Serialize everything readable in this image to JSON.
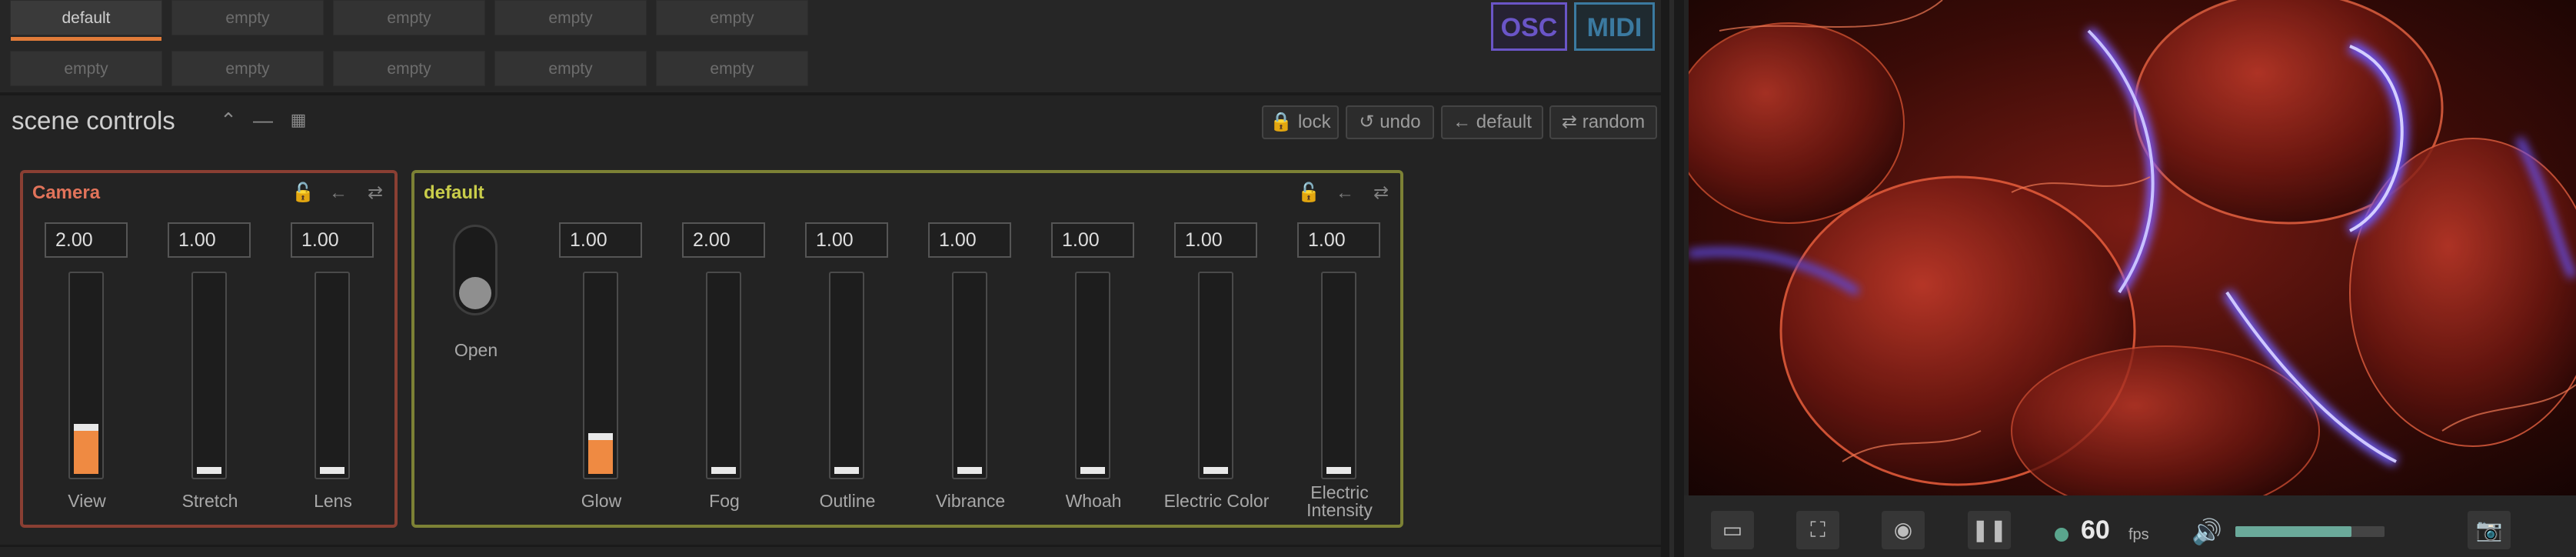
{
  "presets": {
    "row1": [
      "default",
      "empty",
      "empty",
      "empty",
      "empty"
    ],
    "row2": [
      "empty",
      "empty",
      "empty",
      "empty",
      "empty"
    ],
    "active_index": 0
  },
  "protocols": {
    "osc": "OSC",
    "midi": "MIDI"
  },
  "scene": {
    "title": "scene controls",
    "buttons": {
      "lock": "lock",
      "undo": "undo",
      "default": "default",
      "random": "random"
    }
  },
  "groups": {
    "camera": {
      "title": "Camera",
      "color": "#b5513f",
      "controls": [
        {
          "label": "View",
          "value": "2.00",
          "level": 0.22
        },
        {
          "label": "Stretch",
          "value": "1.00",
          "level": 0.0
        },
        {
          "label": "Lens",
          "value": "1.00",
          "level": 0.0
        }
      ]
    },
    "default": {
      "title": "default",
      "color": "#a7ae3e",
      "toggle": {
        "label": "Open",
        "state": "off"
      },
      "controls": [
        {
          "label": "Glow",
          "value": "1.00",
          "level": 0.17
        },
        {
          "label": "Fog",
          "value": "2.00",
          "level": 0.0
        },
        {
          "label": "Outline",
          "value": "1.00",
          "level": 0.0
        },
        {
          "label": "Vibrance",
          "value": "1.00",
          "level": 0.0
        },
        {
          "label": "Whoah",
          "value": "1.00",
          "level": 0.0
        },
        {
          "label": "Electric Color",
          "value": "1.00",
          "level": 0.0
        },
        {
          "label": "Electric Intensity",
          "value": "1.00",
          "level": 0.0
        }
      ]
    }
  },
  "colors": {
    "accent": "#ef8a42",
    "osc": "#6a55c7",
    "midi": "#3b7aa0",
    "fps_dot": "#5aa58d"
  },
  "player": {
    "fps_value": "60",
    "fps_label": "fps",
    "volume": 0.78,
    "icons": [
      "monitor-icon",
      "fullscreen-icon",
      "eye-icon",
      "pause-icon",
      "volume-icon",
      "camera-icon"
    ]
  }
}
